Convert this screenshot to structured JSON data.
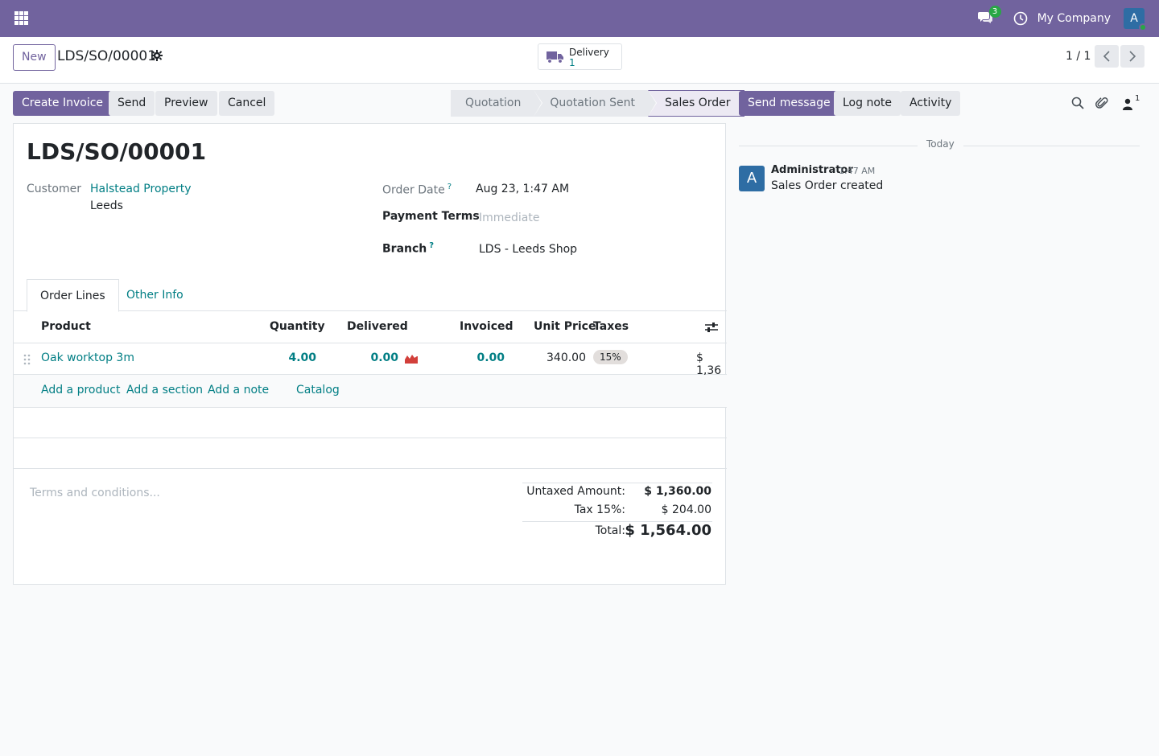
{
  "topbar": {
    "chat_count": "3",
    "company": "My Company",
    "avatar_letter": "A"
  },
  "control": {
    "new_label": "New",
    "record_name": "LDS/SO/00001",
    "smart_button": {
      "label": "Delivery",
      "count": "1"
    },
    "pager": "1 / 1"
  },
  "actions": {
    "create_invoice": "Create Invoice",
    "send": "Send",
    "preview": "Preview",
    "cancel": "Cancel"
  },
  "statusbar": {
    "stages": [
      "Quotation",
      "Quotation Sent",
      "Sales Order"
    ],
    "active": "Sales Order"
  },
  "form": {
    "title": "LDS/SO/00001",
    "customer_label": "Customer",
    "customer_name": "Halstead Property",
    "customer_city": "Leeds",
    "order_date_label": "Order Date",
    "order_date_help": "?",
    "order_date": "Aug 23, 1:47 AM",
    "payment_terms_label": "Payment Terms",
    "payment_terms_placeholder": "Immediate",
    "branch_label": "Branch",
    "branch_help": "?",
    "branch": "LDS - Leeds Shop"
  },
  "tabs": [
    "Order Lines",
    "Other Info"
  ],
  "table": {
    "headers": {
      "product": "Product",
      "quantity": "Quantity",
      "delivered": "Delivered",
      "invoiced": "Invoiced",
      "unit_price": "Unit Price",
      "taxes": "Taxes"
    },
    "rows": [
      {
        "product": "Oak worktop 3m",
        "quantity": "4.00",
        "delivered": "0.00",
        "invoiced": "0.00",
        "unit_price": "340.00",
        "tax": "15%",
        "subtotal": "$ 1,36"
      }
    ],
    "add_product": "Add a product",
    "add_section": "Add a section",
    "add_note": "Add a note",
    "catalog": "Catalog"
  },
  "terms_placeholder": "Terms and conditions...",
  "totals": {
    "untaxed_label": "Untaxed Amount:",
    "untaxed": "$ 1,360.00",
    "tax_label": "Tax 15%:",
    "tax": "$ 204.00",
    "total_label": "Total:",
    "total": "$ 1,564.00"
  },
  "chatter": {
    "send_message": "Send message",
    "log_note": "Log note",
    "activity": "Activity",
    "followers_count": "1",
    "today": "Today",
    "messages": [
      {
        "avatar": "A",
        "author": "Administrator",
        "time": "1:47 AM",
        "body": "Sales Order created"
      }
    ]
  },
  "colors": {
    "brand": "#71639e",
    "link": "#017e84",
    "success": "#28a745"
  }
}
